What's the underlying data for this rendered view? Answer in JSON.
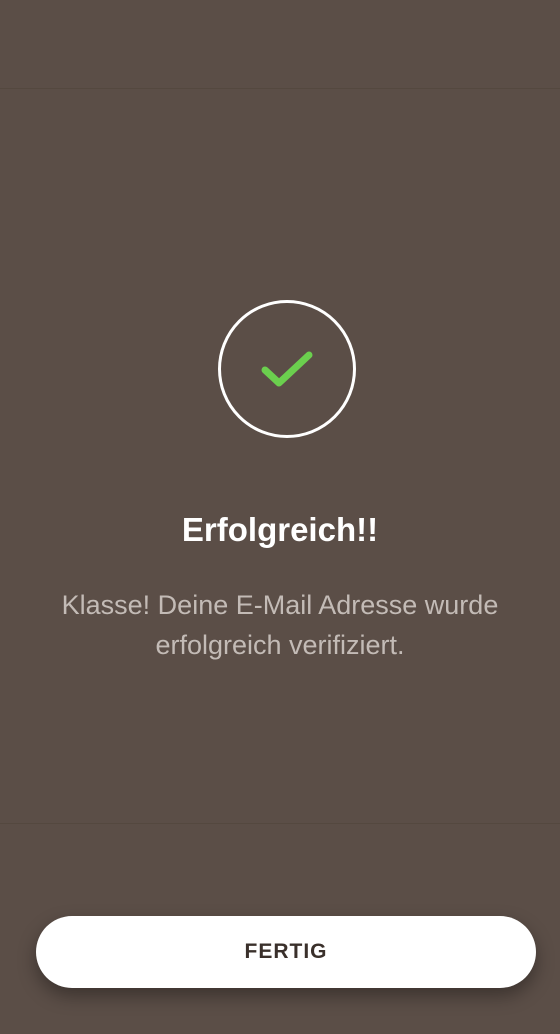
{
  "success": {
    "icon": "checkmark-icon",
    "check_color": "#6bcf4e",
    "title": "Erfolgreich!!",
    "message": "Klasse! Deine E-Mail Adresse wurde erfolgreich verifiziert."
  },
  "actions": {
    "done_label": "FERTIG"
  },
  "theme": {
    "background": "#5b4e47",
    "button_background": "#ffffff",
    "title_color": "#ffffff",
    "message_color": "#c3bbb6"
  }
}
